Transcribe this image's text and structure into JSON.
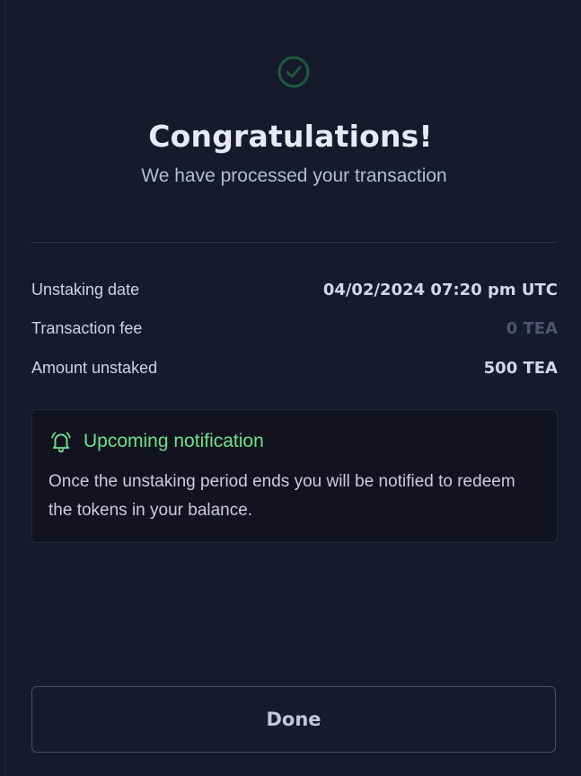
{
  "header": {
    "icon": "check-circle-icon",
    "title": "Congratulations!",
    "subtitle": "We have processed your transaction"
  },
  "details": [
    {
      "label": "Unstaking date",
      "value": "04/02/2024 07:20 pm UTC"
    },
    {
      "label": "Transaction fee",
      "value": "0 TEA"
    },
    {
      "label": "Amount unstaked",
      "value": "500 TEA"
    }
  ],
  "notice": {
    "icon": "bell-icon",
    "title": "Upcoming notification",
    "body": "Once the unstaking period ends you will be notified to redeem the tokens in your balance."
  },
  "actions": {
    "done_label": "Done"
  },
  "colors": {
    "background": "#161a2c",
    "success_green": "#6de08b",
    "icon_green": "#1f5a3a",
    "muted": "#4f5570"
  }
}
